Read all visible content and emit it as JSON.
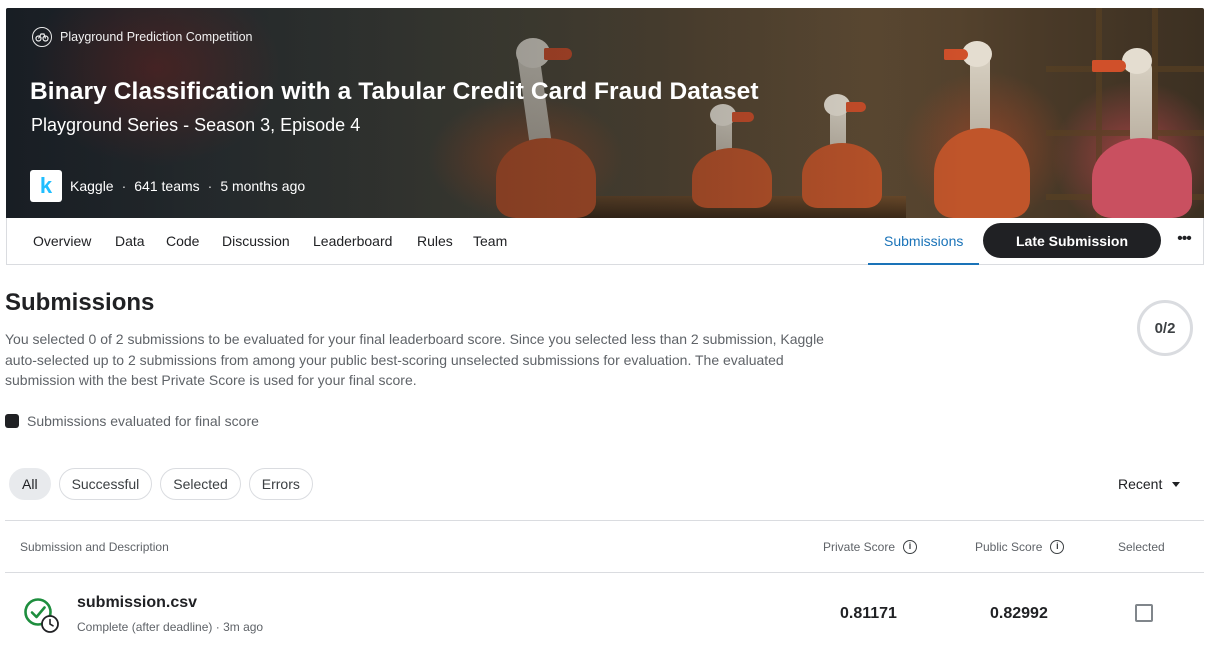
{
  "header": {
    "competition_type": "Playground Prediction Competition",
    "title": "Binary Classification with a Tabular Credit Card Fraud Dataset",
    "subtitle": "Playground Series - Season 3, Episode 4",
    "host_logo_letter": "k",
    "host": "Kaggle",
    "separator": "·",
    "teams": "641 teams",
    "time_ago": "5 months ago"
  },
  "nav": {
    "tabs": [
      "Overview",
      "Data",
      "Code",
      "Discussion",
      "Leaderboard",
      "Rules",
      "Team"
    ],
    "active_tab": "Submissions",
    "late_submission_label": "Late Submission",
    "more_label": "•••"
  },
  "main": {
    "title": "Submissions",
    "description": "You selected 0 of 2 submissions to be evaluated for your final leaderboard score. Since you selected less than 2 submission, Kaggle auto-selected up to 2 submissions from among your public best-scoring unselected submissions for evaluation. The evaluated submission with the best Private Score is used for your final score.",
    "selection_counter": "0/2",
    "legend_label": "Submissions evaluated for final score"
  },
  "filters": {
    "chips": [
      "All",
      "Successful",
      "Selected",
      "Errors"
    ],
    "active": "All",
    "sort_label": "Recent"
  },
  "table": {
    "columns": {
      "submission": "Submission and Description",
      "private_score": "Private Score",
      "public_score": "Public Score",
      "selected": "Selected"
    },
    "info_glyph": "i",
    "rows": [
      {
        "file_name": "submission.csv",
        "status_text": "Complete (after deadline) · 3m ago",
        "private_score": "0.81171",
        "public_score": "0.82992",
        "selected": false
      }
    ]
  },
  "colors": {
    "accent": "#1a73b8",
    "button_dark": "#202124",
    "success_green": "#1e8e3e"
  }
}
